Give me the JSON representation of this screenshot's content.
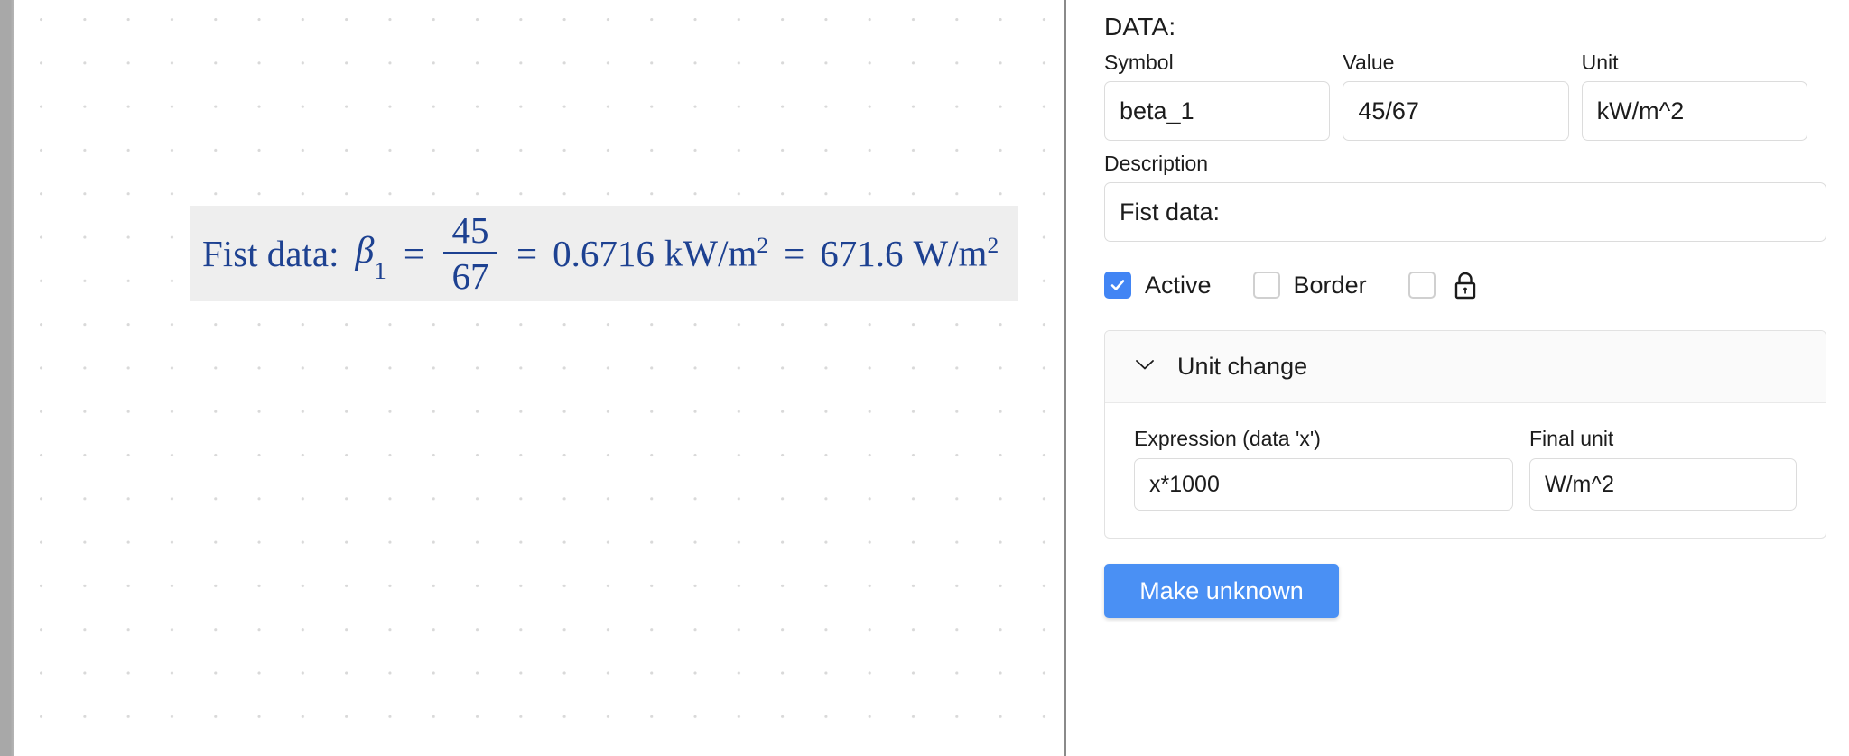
{
  "canvas": {
    "formula": {
      "description_label": "Fist data:",
      "symbol": "β",
      "subscript": "1",
      "equals": "=",
      "numerator": "45",
      "denominator": "67",
      "equals2": "=",
      "result_value": "0.6716",
      "result_unit": "kW/m",
      "result_unit_exp": "2",
      "equals3": "=",
      "converted_value": "671.6",
      "converted_unit": "W/m",
      "converted_unit_exp": "2"
    }
  },
  "panel": {
    "title": "DATA:",
    "fields": {
      "symbol_label": "Symbol",
      "symbol_value": "beta_1",
      "value_label": "Value",
      "value_value": "45/67",
      "unit_label": "Unit",
      "unit_value": "kW/m^2",
      "description_label": "Description",
      "description_value": "Fist data:"
    },
    "checkboxes": {
      "active_label": "Active",
      "active_checked": "true",
      "border_label": "Border",
      "border_checked": "false",
      "lock_checked": "false",
      "lock_icon_name": "lock-icon"
    },
    "accordion": {
      "title": "Unit change",
      "expanded": "true",
      "expression_label": "Expression (data 'x')",
      "expression_value": "x*1000",
      "final_unit_label": "Final unit",
      "final_unit_value": "W/m^2"
    },
    "actions": {
      "make_unknown_label": "Make unknown"
    }
  },
  "colors": {
    "accent": "#4a90f4",
    "checkbox_checked": "#4285f4",
    "formula_text": "#1d4191",
    "formula_bg": "#eeeeee",
    "panel_divider": "#8a8a8a"
  }
}
